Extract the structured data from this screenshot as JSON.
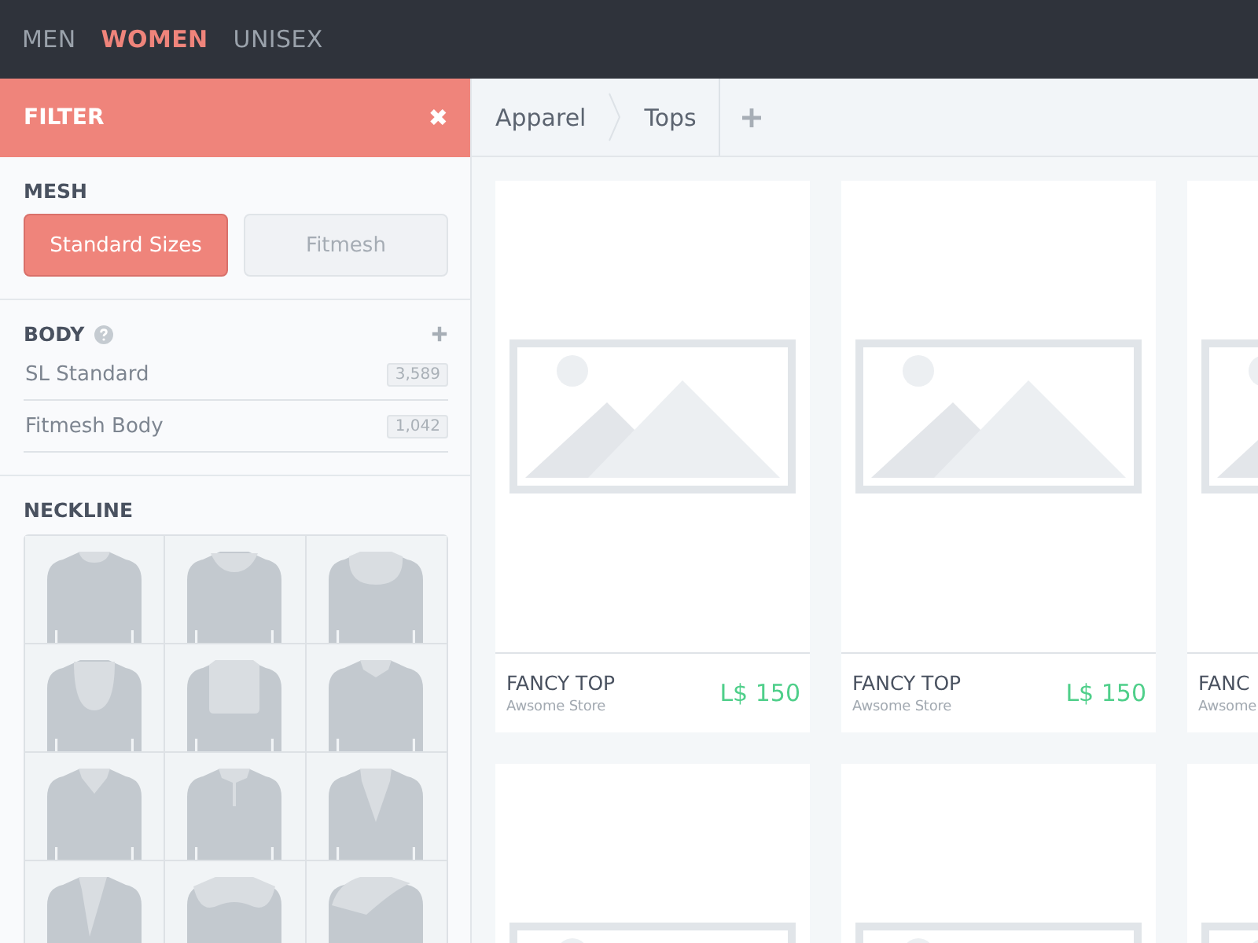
{
  "nav": {
    "tabs": [
      {
        "label": "MEN",
        "selected": false
      },
      {
        "label": "WOMEN",
        "selected": true
      },
      {
        "label": "UNISEX",
        "selected": false
      }
    ]
  },
  "filter": {
    "title": "FILTER",
    "close": "✖",
    "mesh": {
      "title": "MESH",
      "options": [
        {
          "label": "Standard Sizes",
          "selected": true
        },
        {
          "label": "Fitmesh",
          "selected": false
        }
      ]
    },
    "body": {
      "title": "BODY",
      "items": [
        {
          "label": "SL Standard",
          "count": "3,589"
        },
        {
          "label": "Fitmesh Body",
          "count": "1,042"
        }
      ]
    },
    "neckline": {
      "title": "NECKLINE",
      "options": [
        {
          "kind": "crew"
        },
        {
          "kind": "scoop"
        },
        {
          "kind": "round"
        },
        {
          "kind": "u"
        },
        {
          "kind": "square"
        },
        {
          "kind": "notch"
        },
        {
          "kind": "v"
        },
        {
          "kind": "split"
        },
        {
          "kind": "deep-v"
        },
        {
          "kind": "wrap"
        },
        {
          "kind": "off-shoulder"
        },
        {
          "kind": "asymmetric"
        }
      ]
    }
  },
  "breadcrumb": {
    "items": [
      "Apparel",
      "Tops"
    ]
  },
  "products": [
    {
      "kind": "full",
      "name": "FANCY TOP",
      "store": "Awsome Store",
      "price": "L$ 150"
    },
    {
      "kind": "full",
      "name": "FANCY TOP",
      "store": "Awsome Store",
      "price": "L$ 150"
    },
    {
      "kind": "full",
      "name": "FANC",
      "store": "Awsome"
    },
    {
      "kind": "image"
    },
    {
      "kind": "image"
    },
    {
      "kind": "image"
    }
  ]
}
